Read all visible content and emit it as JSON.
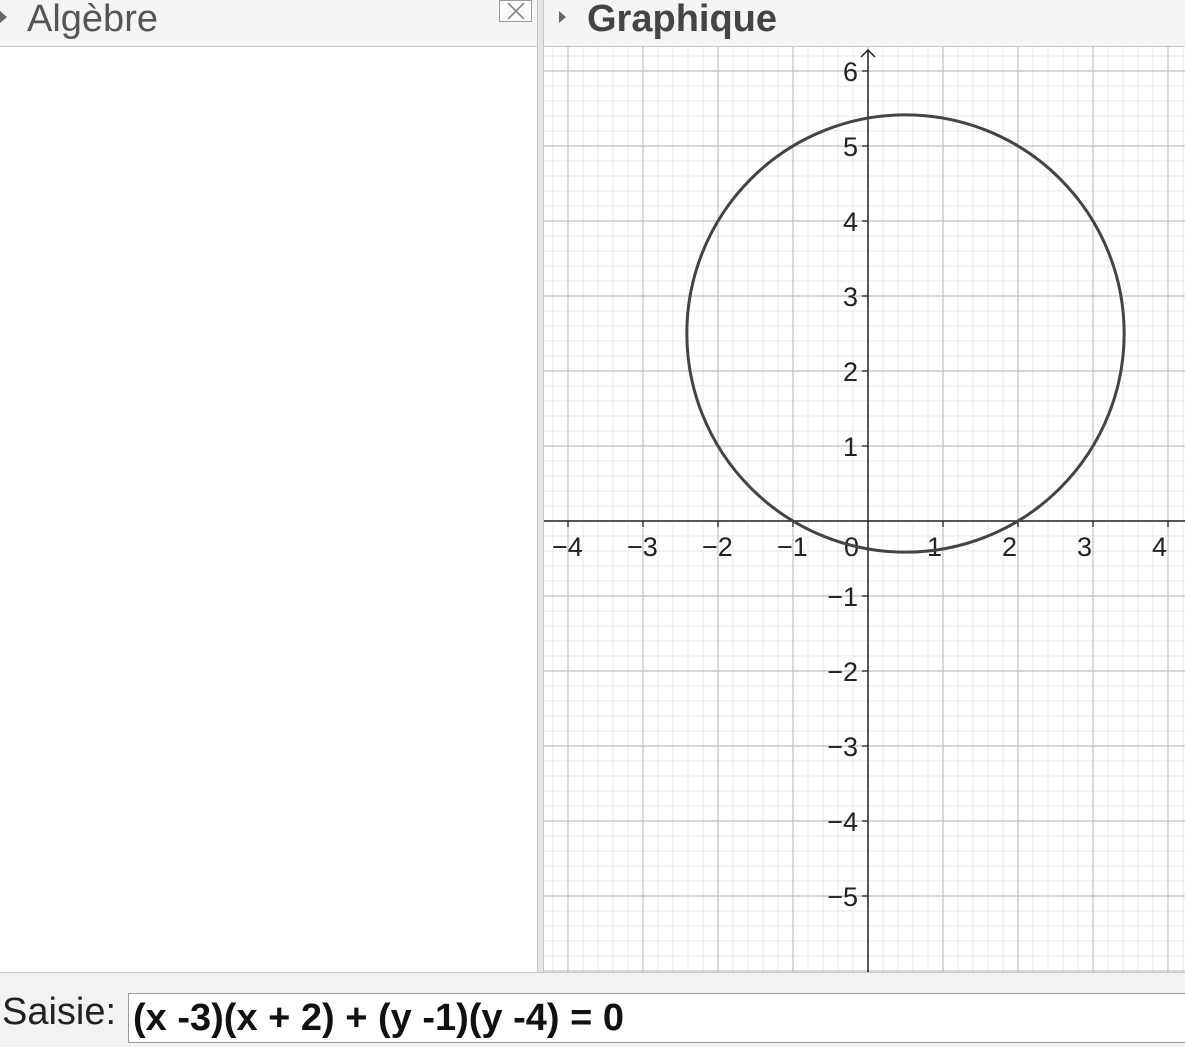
{
  "algebra": {
    "title": "Algèbre",
    "close_icon": "close-icon"
  },
  "graphics": {
    "title": "Graphique",
    "x_ticks": [
      "−4",
      "−3",
      "−2",
      "−1",
      "0",
      "1",
      "2",
      "3",
      "4"
    ],
    "y_ticks": [
      "−5",
      "−4",
      "−3",
      "−2",
      "−1",
      "1",
      "2",
      "3",
      "4",
      "5",
      "6"
    ],
    "x_range": [
      -4.3,
      4.25
    ],
    "y_range": [
      -6.0,
      6.3
    ],
    "grid": true,
    "curve": {
      "type": "circle",
      "equation": "(x -3)(x + 2) + (y -1)(y -4) = 0",
      "center": [
        0.5,
        2.5
      ],
      "radius": 2.9155,
      "color": "#444444"
    }
  },
  "input_bar": {
    "label": "Saisie:",
    "value": "(x -3)(x + 2) + (y -1)(y -4) = 0"
  }
}
